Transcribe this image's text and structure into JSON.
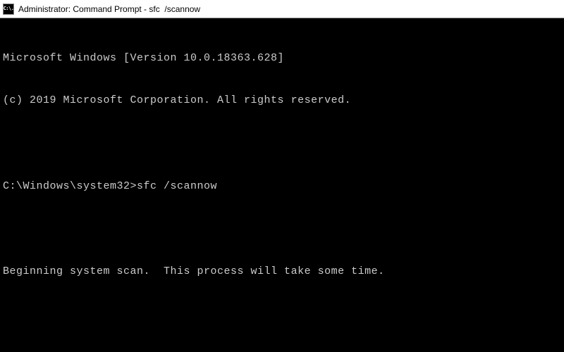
{
  "titlebar": {
    "icon_text": "C:\\.",
    "title": "Administrator: Command Prompt - sfc  /scannow"
  },
  "terminal": {
    "version_line": "Microsoft Windows [Version 10.0.18363.628]",
    "copyright_line": "(c) 2019 Microsoft Corporation. All rights reserved.",
    "prompt": "C:\\Windows\\system32>",
    "command": "sfc /scannow",
    "status_line": "Beginning system scan.  This process will take some time."
  }
}
